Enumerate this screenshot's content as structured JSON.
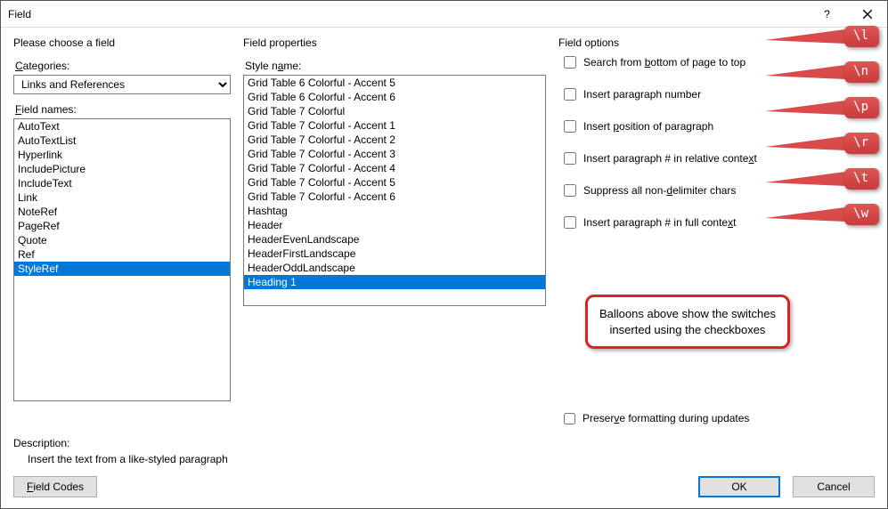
{
  "window": {
    "title": "Field"
  },
  "left": {
    "group": "Please choose a field",
    "categories_label": "Categories:",
    "categories_value": "Links and References",
    "fieldnames_label": "Field names:",
    "fields": [
      "AutoText",
      "AutoTextList",
      "Hyperlink",
      "IncludePicture",
      "IncludeText",
      "Link",
      "NoteRef",
      "PageRef",
      "Quote",
      "Ref",
      "StyleRef"
    ],
    "fields_selected_index": 10
  },
  "middle": {
    "group": "Field properties",
    "stylename_label": "Style name:",
    "styles": [
      "Grid Table 6 Colorful - Accent 5",
      "Grid Table 6 Colorful - Accent 6",
      "Grid Table 7 Colorful",
      "Grid Table 7 Colorful - Accent 1",
      "Grid Table 7 Colorful - Accent 2",
      "Grid Table 7 Colorful - Accent 3",
      "Grid Table 7 Colorful - Accent 4",
      "Grid Table 7 Colorful - Accent 5",
      "Grid Table 7 Colorful - Accent 6",
      "Hashtag",
      "Header",
      "HeaderEvenLandscape",
      "HeaderFirstLandscape",
      "HeaderOddLandscape",
      "Heading 1"
    ],
    "styles_selected_index": 14
  },
  "right": {
    "group": "Field options",
    "options": [
      {
        "label": "Search from bottom of page to top",
        "underline_char": "b",
        "switch": "\\l"
      },
      {
        "label": "Insert paragraph number",
        "underline_char": "",
        "switch": "\\n"
      },
      {
        "label": "Insert position of paragraph",
        "underline_char": "p",
        "switch": "\\p"
      },
      {
        "label": "Insert paragraph # in relative context",
        "underline_char": "x",
        "switch": "\\r"
      },
      {
        "label": "Suppress all non-delimiter chars",
        "underline_char": "d",
        "switch": "\\t"
      },
      {
        "label": "Insert paragraph # in full context",
        "underline_char": "x",
        "switch": "\\w"
      }
    ],
    "preserve_label": "Preserve formatting during updates"
  },
  "callout_text": "Balloons above show the switches inserted using the checkboxes",
  "description": {
    "label": "Description:",
    "text": "Insert the text from a like-styled paragraph"
  },
  "buttons": {
    "field_codes": "Field Codes",
    "ok": "OK",
    "cancel": "Cancel"
  }
}
